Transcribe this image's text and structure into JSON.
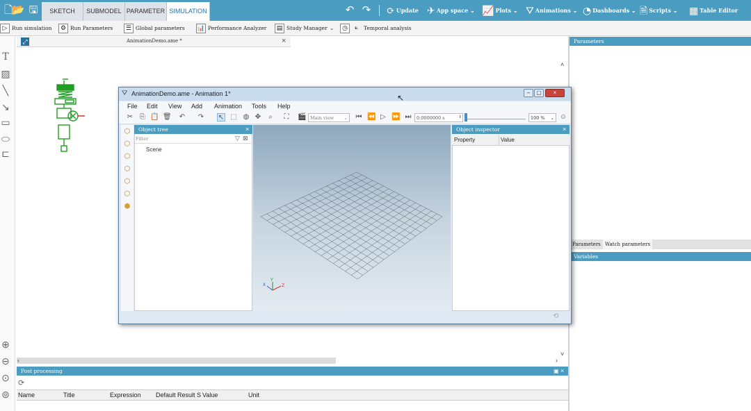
{
  "topbar": {
    "tabs": [
      {
        "label": "SKETCH"
      },
      {
        "label": "SUBMODEL"
      },
      {
        "label": "PARAMETER"
      },
      {
        "label": "SIMULATION"
      }
    ],
    "active_tab": "SIMULATION",
    "actions": {
      "update": "Update",
      "app_space": "App space",
      "plots": "Plots",
      "animations": "Animations",
      "dashboards": "Dashboards",
      "scripts": "Scripts",
      "table_editor": "Table Editor"
    },
    "accent_color": "#4a9cc0"
  },
  "toolbar2": {
    "run_simulation": "Run simulation",
    "run_parameters": "Run Parameters",
    "global_parameters": "Global parameters",
    "performance_analyzer": "Performance Analyzer",
    "study_manager": "Study Manager",
    "temporal_analysis": "Temporal analysis"
  },
  "document": {
    "tab_title": "AnimationDemo.ame *"
  },
  "right_panels": {
    "parameters_title": "Parameters",
    "bottom_tabs": [
      "Parameters",
      "Watch parameters"
    ],
    "variables_title": "Variables"
  },
  "post_processing": {
    "title": "Post processing",
    "columns": [
      "Name",
      "Title",
      "Expression",
      "Default Result S",
      "Value",
      "Unit"
    ]
  },
  "animation_window": {
    "title": "AnimationDemo.ame - Animation 1*",
    "menu": [
      "File",
      "Edit",
      "View",
      "Add",
      "Animation",
      "Tools",
      "Help"
    ],
    "view_select": "Main view",
    "time_value": "0.0000000",
    "time_unit": "s",
    "zoom": "100 %",
    "object_tree": {
      "title": "Object tree",
      "filter_placeholder": "Filter",
      "items": [
        "Scene"
      ]
    },
    "object_inspector": {
      "title": "Object inspector",
      "columns": [
        "Property",
        "Value"
      ]
    },
    "axes": {
      "x": "X",
      "y": "Y",
      "z": "Z"
    }
  }
}
